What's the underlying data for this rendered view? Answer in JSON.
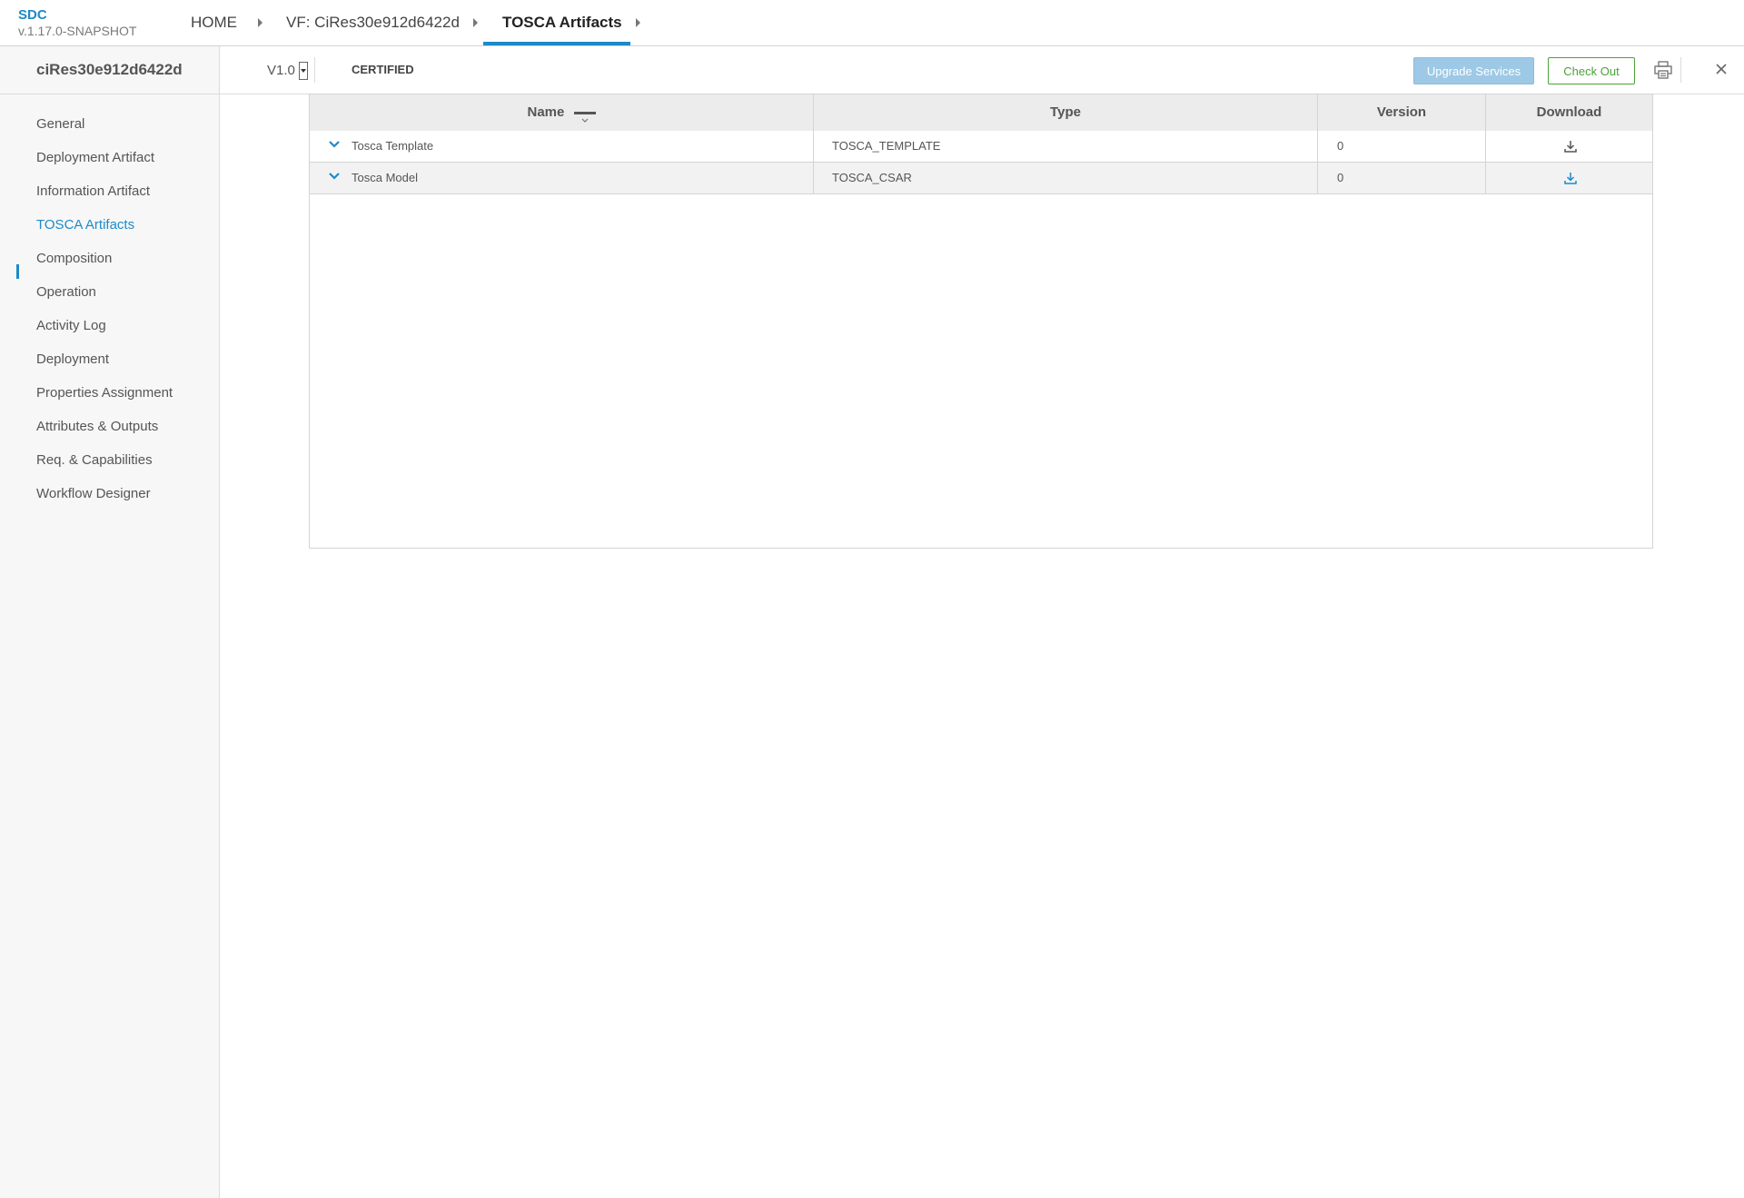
{
  "brand": {
    "title": "SDC",
    "version": "v.1.17.0-SNAPSHOT"
  },
  "breadcrumbs": [
    "HOME",
    "VF: CiRes30e912d6422d",
    "TOSCA Artifacts"
  ],
  "sidebar": {
    "title": "ciRes30e912d6422d",
    "items": [
      {
        "label": "General"
      },
      {
        "label": "Deployment Artifact"
      },
      {
        "label": "Information Artifact"
      },
      {
        "label": "TOSCA Artifacts"
      },
      {
        "label": "Composition"
      },
      {
        "label": "Operation"
      },
      {
        "label": "Activity Log"
      },
      {
        "label": "Deployment"
      },
      {
        "label": "Properties Assignment"
      },
      {
        "label": "Attributes & Outputs"
      },
      {
        "label": "Req. & Capabilities"
      },
      {
        "label": "Workflow Designer"
      }
    ],
    "active_item": "TOSCA Artifacts"
  },
  "subheader": {
    "version": "V1.0",
    "status": "CERTIFIED",
    "upgrade_label": "Upgrade Services",
    "checkout_label": "Check Out"
  },
  "table": {
    "columns": [
      "Name",
      "Type",
      "Version",
      "Download"
    ],
    "rows": [
      {
        "name": "Tosca Template",
        "type": "TOSCA_TEMPLATE",
        "version": "0",
        "download_icon": "download-icon"
      },
      {
        "name": "Tosca Model",
        "type": "TOSCA_CSAR",
        "version": "0",
        "download_icon": "download-icon"
      }
    ]
  },
  "colors": {
    "accent": "#1d8ac8",
    "certify_green": "#4aa23a",
    "upgrade_button_bg": "#9dc9e6",
    "header_bg": "#ececec"
  }
}
